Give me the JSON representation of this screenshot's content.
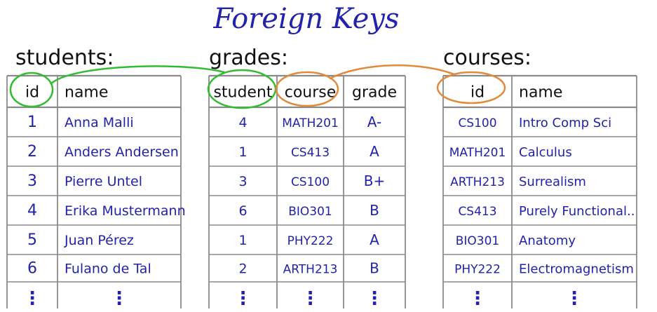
{
  "title": "Foreign Keys",
  "tables": {
    "students": {
      "label": "students:",
      "columns": [
        "id",
        "name"
      ],
      "rows": [
        [
          "1",
          "Anna Malli"
        ],
        [
          "2",
          "Anders Andersen"
        ],
        [
          "3",
          "Pierre Untel"
        ],
        [
          "4",
          "Erika Mustermann"
        ],
        [
          "5",
          "Juan Pérez"
        ],
        [
          "6",
          "Fulano de Tal"
        ]
      ],
      "continuation": [
        "⋮",
        "⋮"
      ]
    },
    "grades": {
      "label": "grades:",
      "columns": [
        "student",
        "course",
        "grade"
      ],
      "rows": [
        [
          "4",
          "MATH201",
          "A-"
        ],
        [
          "1",
          "CS413",
          "A"
        ],
        [
          "3",
          "CS100",
          "B+"
        ],
        [
          "6",
          "BIO301",
          "B"
        ],
        [
          "1",
          "PHY222",
          "A"
        ],
        [
          "2",
          "ARTH213",
          "B"
        ]
      ],
      "continuation": [
        "⋮",
        "⋮",
        "⋮"
      ]
    },
    "courses": {
      "label": "courses:",
      "columns": [
        "id",
        "name"
      ],
      "rows": [
        [
          "CS100",
          "Intro Comp Sci"
        ],
        [
          "MATH201",
          "Calculus"
        ],
        [
          "ARTH213",
          "Surrealism"
        ],
        [
          "CS413",
          "Purely Functional.."
        ],
        [
          "BIO301",
          "Anatomy"
        ],
        [
          "PHY222",
          "Electromagnetism"
        ]
      ],
      "continuation": [
        "⋮",
        "⋮"
      ]
    }
  },
  "colors": {
    "ink": "#2222aa",
    "label_ink": "#111111",
    "grid": "#8a8a8a",
    "link_students": "#33bb33",
    "link_courses": "#e08a3a"
  }
}
